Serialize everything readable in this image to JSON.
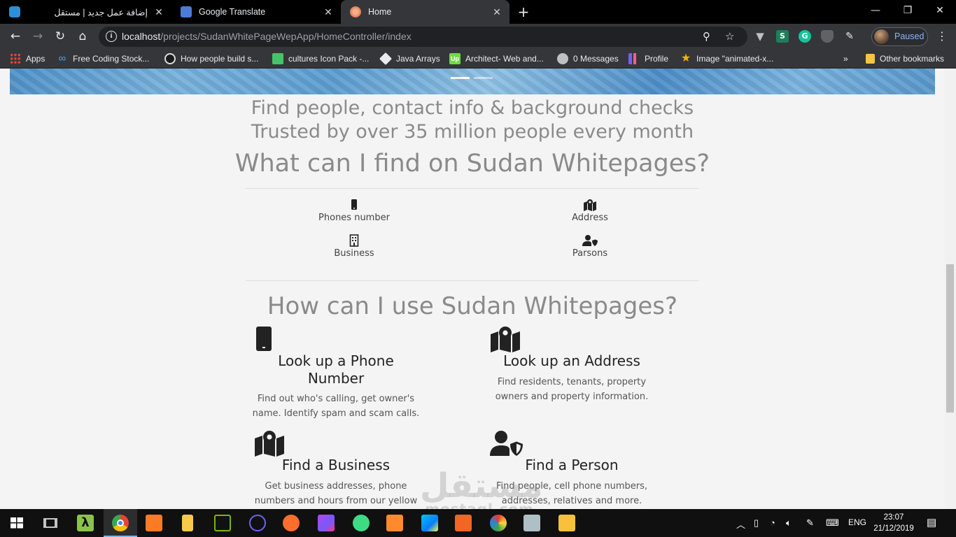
{
  "browser": {
    "tabs": [
      {
        "title": "إضافة عمل جديد | مستقل"
      },
      {
        "title": "Google Translate"
      },
      {
        "title": "Home"
      }
    ],
    "url_host": "localhost",
    "url_path": "/projects/SudanWhitePageWepApp/HomeController/index",
    "profile_label": "Paused",
    "colors": {
      "tab_active": "#35363a",
      "titlebar": "#000000",
      "link": "#8ab4f8"
    }
  },
  "bookmarks": {
    "items": [
      {
        "label": "Apps",
        "icon": "apps-grid-icon"
      },
      {
        "label": "Free Coding Stock...",
        "icon": "infinity-icon"
      },
      {
        "label": "How people build s...",
        "icon": "github-icon"
      },
      {
        "label": "cultures Icon Pack -...",
        "icon": "iconpack-icon"
      },
      {
        "label": "Java Arrays",
        "icon": "java-icon"
      },
      {
        "label": "Architect- Web and...",
        "icon": "upwork-icon"
      },
      {
        "label": "0 Messages",
        "icon": "globe-icon"
      },
      {
        "label": "Profile",
        "icon": "profile-icon"
      },
      {
        "label": "Image \"animated-x...",
        "icon": "star-image-icon"
      }
    ],
    "more": "»",
    "other": "Other bookmarks"
  },
  "page": {
    "headline_1": "Find people, contact info & background checks",
    "headline_2": "Trusted by over 35 million people every month",
    "what_title": "What can I find on Sudan Whitepages?",
    "categories": [
      {
        "label": "Phones number",
        "icon": "phone-icon"
      },
      {
        "label": "Address",
        "icon": "map-marker-icon"
      },
      {
        "label": "Business",
        "icon": "building-icon"
      },
      {
        "label": "Parsons",
        "icon": "user-shield-icon"
      }
    ],
    "how_title": "How can I use Sudan Whitepages?",
    "features": [
      {
        "title": "Look up a Phone Number",
        "desc": "Find out who's calling, get owner's name. Identify spam and scam calls.",
        "icon": "phone-icon"
      },
      {
        "title": "Look up an Address",
        "desc": "Find residents, tenants, property owners and property information.",
        "icon": "map-marker-icon"
      },
      {
        "title": "Find a Business",
        "desc": "Get business addresses, phone numbers and hours from our yellow",
        "icon": "map-marker-icon"
      },
      {
        "title": "Find a Person",
        "desc": "Find people, cell phone numbers, addresses, relatives and more.",
        "icon": "user-shield-icon"
      }
    ],
    "watermark_1": "مستقل",
    "watermark_2": "mostaql.com"
  },
  "taskbar": {
    "language": "ENG",
    "time": "23:07",
    "date": "21/12/2019"
  }
}
